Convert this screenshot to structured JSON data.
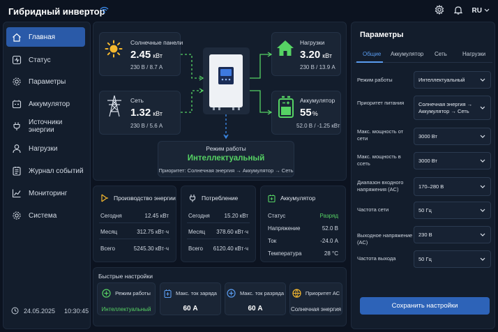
{
  "header": {
    "title": "Гибридный инвертор",
    "lang": "RU"
  },
  "sidebar": {
    "items": [
      {
        "label": "Главная",
        "icon": "home-icon",
        "active": true
      },
      {
        "label": "Статус",
        "icon": "status-icon"
      },
      {
        "label": "Параметры",
        "icon": "gear-icon"
      },
      {
        "label": "Аккумулятор",
        "icon": "battery-icon"
      },
      {
        "label": "Источники энергии",
        "icon": "plug-icon"
      },
      {
        "label": "Нагрузки",
        "icon": "user-icon"
      },
      {
        "label": "Журнал событий",
        "icon": "log-icon"
      },
      {
        "label": "Мониторинг",
        "icon": "chart-icon"
      },
      {
        "label": "Система",
        "icon": "settings-icon"
      }
    ],
    "date": "24.05.2025",
    "time": "10:30:45"
  },
  "flow": {
    "solar": {
      "title": "Солнечные панели",
      "value": "2.45",
      "unit": "кВт",
      "sub": "230 В / 8.7 А"
    },
    "grid": {
      "title": "Сеть",
      "value": "1.32",
      "unit": "кВт",
      "sub": "230 В / 5.6 А"
    },
    "load": {
      "title": "Нагрузки",
      "value": "3.20",
      "unit": "кВт",
      "sub": "230 В / 13.9 А"
    },
    "battery": {
      "title": "Аккумулятор",
      "value": "55",
      "unit": "%",
      "sub": "52.0 В / -1.25 кВт"
    },
    "mode": {
      "title": "Режим работы",
      "value": "Интеллектуальный",
      "priority": "Приоритет: Солнечная энергия → Аккумулятор → Сеть"
    }
  },
  "stats": {
    "production": {
      "title": "Производство энергии",
      "rows": [
        {
          "label": "Сегодня",
          "value": "12.45 кВт"
        },
        {
          "label": "Месяц",
          "value": "312.75 кВт·ч"
        },
        {
          "label": "Всего",
          "value": "5245.30 кВт·ч"
        }
      ]
    },
    "consumption": {
      "title": "Потребление",
      "rows": [
        {
          "label": "Сегодня",
          "value": "15.20 кВт"
        },
        {
          "label": "Месяц",
          "value": "378.60 кВт·ч"
        },
        {
          "label": "Всего",
          "value": "6120.40 кВт·ч"
        }
      ]
    },
    "battery": {
      "title": "Аккумулятор",
      "rows": [
        {
          "label": "Статус",
          "value": "Разряд"
        },
        {
          "label": "Напряжение",
          "value": "52.0 В"
        },
        {
          "label": "Ток",
          "value": "-24.0 А"
        },
        {
          "label": "Температура",
          "value": "28 °C"
        }
      ]
    }
  },
  "quick": {
    "title": "Быстрые настройки",
    "items": [
      {
        "label": "Режим работы",
        "value": "Интеллектуальный"
      },
      {
        "label": "Макс. ток заряда",
        "value": "60 А"
      },
      {
        "label": "Макс. ток разряда",
        "value": "60 А"
      },
      {
        "label": "Приоритет АС",
        "value": "Солнечная энергия"
      }
    ]
  },
  "params": {
    "title": "Параметры",
    "tabs": [
      "Общие",
      "Аккумулятор",
      "Сеть",
      "Нагрузки"
    ],
    "rows": [
      {
        "label": "Режим работы",
        "value": "Интеллектуальный"
      },
      {
        "label": "Приоритет питания",
        "value": "Солнечная энергия → Аккумулятор → Сеть"
      },
      {
        "label": "Макс. мощность от сети",
        "value": "3000 Вт"
      },
      {
        "label": "Макс. мощность в ссеть",
        "value": "3000 Вт"
      },
      {
        "label": "Диапазон входного напряжения (АС)",
        "value": "170–280 В"
      },
      {
        "label": "Частота сети",
        "value": "50 Гц"
      },
      {
        "label": "Выходное напряжение (АС)",
        "value": "230 В"
      },
      {
        "label": "Частота выхода",
        "value": "50 Гц"
      }
    ],
    "save_label": "Сохранить настройки"
  },
  "colors": {
    "accent": "#2a5aa8",
    "green": "#56d364",
    "solar": "#f5b82e",
    "bg": "#0c1320"
  }
}
